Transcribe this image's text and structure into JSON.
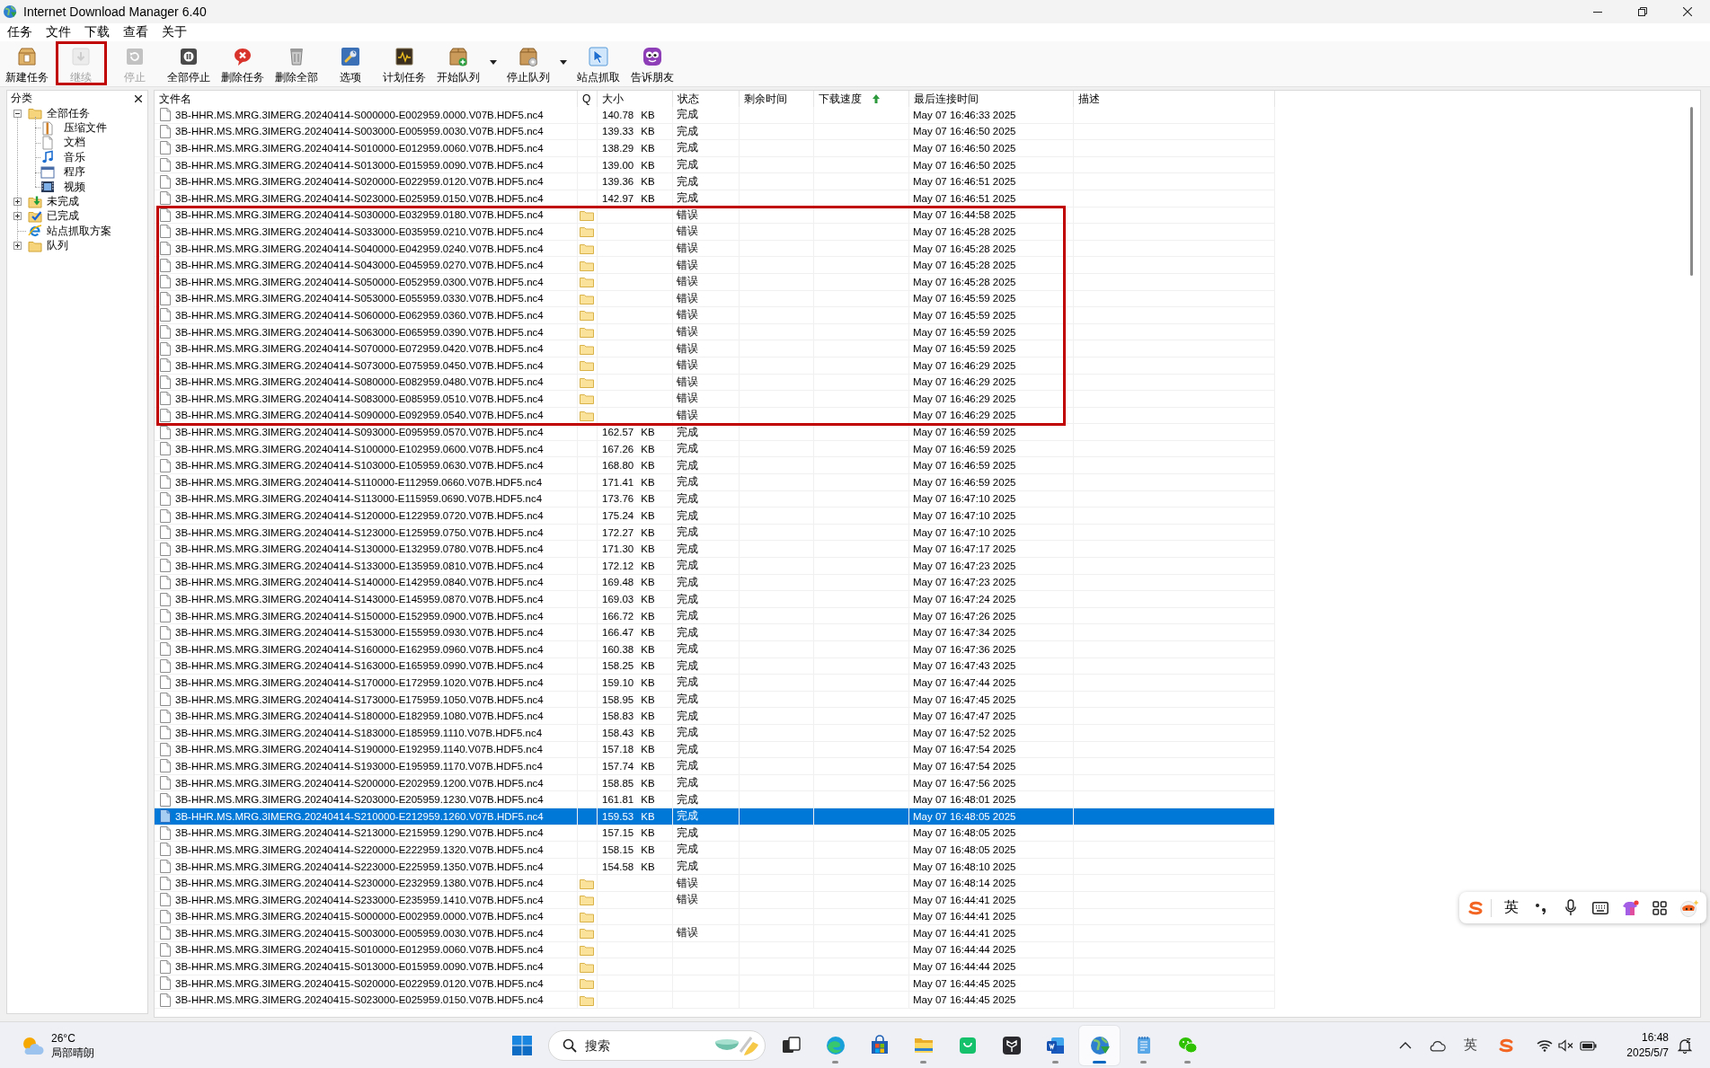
{
  "window": {
    "title": "Internet Download Manager 6.40"
  },
  "menu": [
    "任务",
    "文件",
    "下载",
    "查看",
    "关于"
  ],
  "toolbar": [
    {
      "kind": "button",
      "label": "新建任务",
      "disabled": false,
      "dropdown": false
    },
    {
      "kind": "framed_button",
      "label": "继续",
      "disabled": true,
      "dropdown": false
    },
    {
      "kind": "button",
      "label": "停止",
      "disabled": true,
      "dropdown": false
    },
    {
      "kind": "button",
      "label": "全部停止",
      "disabled": false,
      "dropdown": false
    },
    {
      "kind": "button",
      "label": "删除任务",
      "disabled": false,
      "dropdown": false
    },
    {
      "kind": "button",
      "label": "删除全部",
      "disabled": false,
      "dropdown": false
    },
    {
      "kind": "button",
      "label": "选项",
      "disabled": false,
      "dropdown": false
    },
    {
      "kind": "button",
      "label": "计划任务",
      "disabled": false,
      "dropdown": false
    },
    {
      "kind": "button",
      "label": "开始队列",
      "disabled": false,
      "dropdown": true
    },
    {
      "kind": "button",
      "label": "停止队列",
      "disabled": false,
      "dropdown": true
    },
    {
      "kind": "button",
      "label": "站点抓取",
      "disabled": false,
      "dropdown": false
    },
    {
      "kind": "button",
      "label": "告诉朋友",
      "disabled": false,
      "dropdown": false
    }
  ],
  "sidebar": {
    "title": "分类",
    "tree": [
      {
        "label": "全部任务",
        "expanded": true,
        "children": [
          {
            "label": "压缩文件"
          },
          {
            "label": "文档"
          },
          {
            "label": "音乐"
          },
          {
            "label": "程序"
          },
          {
            "label": "视频"
          }
        ]
      },
      {
        "label": "未完成",
        "expanded": false
      },
      {
        "label": "已完成",
        "expanded": false
      },
      {
        "label": "站点抓取方案"
      },
      {
        "label": "队列",
        "expanded": false
      }
    ]
  },
  "table": {
    "columns": [
      {
        "label": "文件名",
        "sorted": false
      },
      {
        "label": "Q",
        "sorted": false
      },
      {
        "label": "大小",
        "sorted": false
      },
      {
        "label": "状态",
        "sorted": false
      },
      {
        "label": "剩余时间",
        "sorted": false
      },
      {
        "label": "下载速度",
        "sorted": true
      },
      {
        "label": "最后连接时间",
        "sorted": false
      },
      {
        "label": "描述",
        "sorted": false
      }
    ],
    "rows": [
      {
        "kind": "file",
        "name": "3B-HHR.MS.MRG.3IMERG.20240414-S000000-E002959.0000.V07B.HDF5.nc4",
        "queued": false,
        "size": "140.78 KB",
        "status": "完成",
        "last_connection": "May 07 16:46:33 2025",
        "selected": false
      },
      {
        "kind": "file",
        "name": "3B-HHR.MS.MRG.3IMERG.20240414-S003000-E005959.0030.V07B.HDF5.nc4",
        "queued": false,
        "size": "139.33 KB",
        "status": "完成",
        "last_connection": "May 07 16:46:50 2025",
        "selected": false
      },
      {
        "kind": "file",
        "name": "3B-HHR.MS.MRG.3IMERG.20240414-S010000-E012959.0060.V07B.HDF5.nc4",
        "queued": false,
        "size": "138.29 KB",
        "status": "完成",
        "last_connection": "May 07 16:46:50 2025",
        "selected": false
      },
      {
        "kind": "file",
        "name": "3B-HHR.MS.MRG.3IMERG.20240414-S013000-E015959.0090.V07B.HDF5.nc4",
        "queued": false,
        "size": "139.00 KB",
        "status": "完成",
        "last_connection": "May 07 16:46:50 2025",
        "selected": false
      },
      {
        "kind": "file",
        "name": "3B-HHR.MS.MRG.3IMERG.20240414-S020000-E022959.0120.V07B.HDF5.nc4",
        "queued": false,
        "size": "139.36 KB",
        "status": "完成",
        "last_connection": "May 07 16:46:51 2025",
        "selected": false
      },
      {
        "kind": "file",
        "name": "3B-HHR.MS.MRG.3IMERG.20240414-S023000-E025959.0150.V07B.HDF5.nc4",
        "queued": false,
        "size": "142.97 KB",
        "status": "完成",
        "last_connection": "May 07 16:46:51 2025",
        "selected": false
      },
      {
        "kind": "frame",
        "rows": [
          {
            "name": "3B-HHR.MS.MRG.3IMERG.20240414-S030000-E032959.0180.V07B.HDF5.nc4",
            "queued": true,
            "status": "错误",
            "last_connection": "May 07 16:44:58 2025",
            "selected": false
          },
          {
            "name": "3B-HHR.MS.MRG.3IMERG.20240414-S033000-E035959.0210.V07B.HDF5.nc4",
            "queued": true,
            "status": "错误",
            "last_connection": "May 07 16:45:28 2025",
            "selected": false
          },
          {
            "name": "3B-HHR.MS.MRG.3IMERG.20240414-S040000-E042959.0240.V07B.HDF5.nc4",
            "queued": true,
            "status": "错误",
            "last_connection": "May 07 16:45:28 2025",
            "selected": false
          },
          {
            "name": "3B-HHR.MS.MRG.3IMERG.20240414-S043000-E045959.0270.V07B.HDF5.nc4",
            "queued": true,
            "status": "错误",
            "last_connection": "May 07 16:45:28 2025",
            "selected": false
          },
          {
            "name": "3B-HHR.MS.MRG.3IMERG.20240414-S050000-E052959.0300.V07B.HDF5.nc4",
            "queued": true,
            "status": "错误",
            "last_connection": "May 07 16:45:28 2025",
            "selected": false
          },
          {
            "name": "3B-HHR.MS.MRG.3IMERG.20240414-S053000-E055959.0330.V07B.HDF5.nc4",
            "queued": true,
            "status": "错误",
            "last_connection": "May 07 16:45:59 2025",
            "selected": false
          },
          {
            "name": "3B-HHR.MS.MRG.3IMERG.20240414-S060000-E062959.0360.V07B.HDF5.nc4",
            "queued": true,
            "status": "错误",
            "last_connection": "May 07 16:45:59 2025",
            "selected": false
          },
          {
            "name": "3B-HHR.MS.MRG.3IMERG.20240414-S063000-E065959.0390.V07B.HDF5.nc4",
            "queued": true,
            "status": "错误",
            "last_connection": "May 07 16:45:59 2025",
            "selected": false
          },
          {
            "name": "3B-HHR.MS.MRG.3IMERG.20240414-S070000-E072959.0420.V07B.HDF5.nc4",
            "queued": true,
            "status": "错误",
            "last_connection": "May 07 16:45:59 2025",
            "selected": false
          },
          {
            "name": "3B-HHR.MS.MRG.3IMERG.20240414-S073000-E075959.0450.V07B.HDF5.nc4",
            "queued": true,
            "status": "错误",
            "last_connection": "May 07 16:46:29 2025",
            "selected": false
          },
          {
            "name": "3B-HHR.MS.MRG.3IMERG.20240414-S080000-E082959.0480.V07B.HDF5.nc4",
            "queued": true,
            "status": "错误",
            "last_connection": "May 07 16:46:29 2025",
            "selected": false
          },
          {
            "name": "3B-HHR.MS.MRG.3IMERG.20240414-S083000-E085959.0510.V07B.HDF5.nc4",
            "queued": true,
            "status": "错误",
            "last_connection": "May 07 16:46:29 2025",
            "selected": false
          },
          {
            "name": "3B-HHR.MS.MRG.3IMERG.20240414-S090000-E092959.0540.V07B.HDF5.nc4",
            "queued": true,
            "status": "错误",
            "last_connection": "May 07 16:46:29 2025",
            "selected": false
          }
        ]
      },
      {
        "kind": "file",
        "name": "3B-HHR.MS.MRG.3IMERG.20240414-S093000-E095959.0570.V07B.HDF5.nc4",
        "queued": false,
        "size": "162.57 KB",
        "status": "完成",
        "last_connection": "May 07 16:46:59 2025",
        "selected": false
      },
      {
        "kind": "file",
        "name": "3B-HHR.MS.MRG.3IMERG.20240414-S100000-E102959.0600.V07B.HDF5.nc4",
        "queued": false,
        "size": "167.26 KB",
        "status": "完成",
        "last_connection": "May 07 16:46:59 2025",
        "selected": false
      },
      {
        "kind": "file",
        "name": "3B-HHR.MS.MRG.3IMERG.20240414-S103000-E105959.0630.V07B.HDF5.nc4",
        "queued": false,
        "size": "168.80 KB",
        "status": "完成",
        "last_connection": "May 07 16:46:59 2025",
        "selected": false
      },
      {
        "kind": "file",
        "name": "3B-HHR.MS.MRG.3IMERG.20240414-S110000-E112959.0660.V07B.HDF5.nc4",
        "queued": false,
        "size": "171.41 KB",
        "status": "完成",
        "last_connection": "May 07 16:46:59 2025",
        "selected": false
      },
      {
        "kind": "file",
        "name": "3B-HHR.MS.MRG.3IMERG.20240414-S113000-E115959.0690.V07B.HDF5.nc4",
        "queued": false,
        "size": "173.76 KB",
        "status": "完成",
        "last_connection": "May 07 16:47:10 2025",
        "selected": false
      },
      {
        "kind": "file",
        "name": "3B-HHR.MS.MRG.3IMERG.20240414-S120000-E122959.0720.V07B.HDF5.nc4",
        "queued": false,
        "size": "175.24 KB",
        "status": "完成",
        "last_connection": "May 07 16:47:10 2025",
        "selected": false
      },
      {
        "kind": "file",
        "name": "3B-HHR.MS.MRG.3IMERG.20240414-S123000-E125959.0750.V07B.HDF5.nc4",
        "queued": false,
        "size": "172.27 KB",
        "status": "完成",
        "last_connection": "May 07 16:47:10 2025",
        "selected": false
      },
      {
        "kind": "file",
        "name": "3B-HHR.MS.MRG.3IMERG.20240414-S130000-E132959.0780.V07B.HDF5.nc4",
        "queued": false,
        "size": "171.30 KB",
        "status": "完成",
        "last_connection": "May 07 16:47:17 2025",
        "selected": false
      },
      {
        "kind": "file",
        "name": "3B-HHR.MS.MRG.3IMERG.20240414-S133000-E135959.0810.V07B.HDF5.nc4",
        "queued": false,
        "size": "172.12 KB",
        "status": "完成",
        "last_connection": "May 07 16:47:23 2025",
        "selected": false
      },
      {
        "kind": "file",
        "name": "3B-HHR.MS.MRG.3IMERG.20240414-S140000-E142959.0840.V07B.HDF5.nc4",
        "queued": false,
        "size": "169.48 KB",
        "status": "完成",
        "last_connection": "May 07 16:47:23 2025",
        "selected": false
      },
      {
        "kind": "file",
        "name": "3B-HHR.MS.MRG.3IMERG.20240414-S143000-E145959.0870.V07B.HDF5.nc4",
        "queued": false,
        "size": "169.03 KB",
        "status": "完成",
        "last_connection": "May 07 16:47:24 2025",
        "selected": false
      },
      {
        "kind": "file",
        "name": "3B-HHR.MS.MRG.3IMERG.20240414-S150000-E152959.0900.V07B.HDF5.nc4",
        "queued": false,
        "size": "166.72 KB",
        "status": "完成",
        "last_connection": "May 07 16:47:26 2025",
        "selected": false
      },
      {
        "kind": "file",
        "name": "3B-HHR.MS.MRG.3IMERG.20240414-S153000-E155959.0930.V07B.HDF5.nc4",
        "queued": false,
        "size": "166.47 KB",
        "status": "完成",
        "last_connection": "May 07 16:47:34 2025",
        "selected": false
      },
      {
        "kind": "file",
        "name": "3B-HHR.MS.MRG.3IMERG.20240414-S160000-E162959.0960.V07B.HDF5.nc4",
        "queued": false,
        "size": "160.38 KB",
        "status": "完成",
        "last_connection": "May 07 16:47:36 2025",
        "selected": false
      },
      {
        "kind": "file",
        "name": "3B-HHR.MS.MRG.3IMERG.20240414-S163000-E165959.0990.V07B.HDF5.nc4",
        "queued": false,
        "size": "158.25 KB",
        "status": "完成",
        "last_connection": "May 07 16:47:43 2025",
        "selected": false
      },
      {
        "kind": "file",
        "name": "3B-HHR.MS.MRG.3IMERG.20240414-S170000-E172959.1020.V07B.HDF5.nc4",
        "queued": false,
        "size": "159.10 KB",
        "status": "完成",
        "last_connection": "May 07 16:47:44 2025",
        "selected": false
      },
      {
        "kind": "file",
        "name": "3B-HHR.MS.MRG.3IMERG.20240414-S173000-E175959.1050.V07B.HDF5.nc4",
        "queued": false,
        "size": "158.95 KB",
        "status": "完成",
        "last_connection": "May 07 16:47:45 2025",
        "selected": false
      },
      {
        "kind": "file",
        "name": "3B-HHR.MS.MRG.3IMERG.20240414-S180000-E182959.1080.V07B.HDF5.nc4",
        "queued": false,
        "size": "158.83 KB",
        "status": "完成",
        "last_connection": "May 07 16:47:47 2025",
        "selected": false
      },
      {
        "kind": "file",
        "name": "3B-HHR.MS.MRG.3IMERG.20240414-S183000-E185959.1110.V07B.HDF5.nc4",
        "queued": false,
        "size": "158.43 KB",
        "status": "完成",
        "last_connection": "May 07 16:47:52 2025",
        "selected": false
      },
      {
        "kind": "file",
        "name": "3B-HHR.MS.MRG.3IMERG.20240414-S190000-E192959.1140.V07B.HDF5.nc4",
        "queued": false,
        "size": "157.18 KB",
        "status": "完成",
        "last_connection": "May 07 16:47:54 2025",
        "selected": false
      },
      {
        "kind": "file",
        "name": "3B-HHR.MS.MRG.3IMERG.20240414-S193000-E195959.1170.V07B.HDF5.nc4",
        "queued": false,
        "size": "157.74 KB",
        "status": "完成",
        "last_connection": "May 07 16:47:54 2025",
        "selected": false
      },
      {
        "kind": "file",
        "name": "3B-HHR.MS.MRG.3IMERG.20240414-S200000-E202959.1200.V07B.HDF5.nc4",
        "queued": false,
        "size": "158.85 KB",
        "status": "完成",
        "last_connection": "May 07 16:47:56 2025",
        "selected": false
      },
      {
        "kind": "file",
        "name": "3B-HHR.MS.MRG.3IMERG.20240414-S203000-E205959.1230.V07B.HDF5.nc4",
        "queued": false,
        "size": "161.81 KB",
        "status": "完成",
        "last_connection": "May 07 16:48:01 2025",
        "selected": false
      },
      {
        "kind": "file",
        "name": "3B-HHR.MS.MRG.3IMERG.20240414-S210000-E212959.1260.V07B.HDF5.nc4",
        "queued": false,
        "size": "159.53 KB",
        "status": "完成",
        "last_connection": "May 07 16:48:05 2025",
        "selected": true
      },
      {
        "kind": "file",
        "name": "3B-HHR.MS.MRG.3IMERG.20240414-S213000-E215959.1290.V07B.HDF5.nc4",
        "queued": false,
        "size": "157.15 KB",
        "status": "完成",
        "last_connection": "May 07 16:48:05 2025",
        "selected": false
      },
      {
        "kind": "file",
        "name": "3B-HHR.MS.MRG.3IMERG.20240414-S220000-E222959.1320.V07B.HDF5.nc4",
        "queued": false,
        "size": "158.15 KB",
        "status": "完成",
        "last_connection": "May 07 16:48:05 2025",
        "selected": false
      },
      {
        "kind": "file",
        "name": "3B-HHR.MS.MRG.3IMERG.20240414-S223000-E225959.1350.V07B.HDF5.nc4",
        "queued": false,
        "size": "154.58 KB",
        "status": "完成",
        "last_connection": "May 07 16:48:10 2025",
        "selected": false
      },
      {
        "kind": "file",
        "name": "3B-HHR.MS.MRG.3IMERG.20240414-S230000-E232959.1380.V07B.HDF5.nc4",
        "queued": true,
        "status": "错误",
        "last_connection": "May 07 16:48:14 2025",
        "selected": false
      },
      {
        "kind": "file",
        "name": "3B-HHR.MS.MRG.3IMERG.20240414-S233000-E235959.1410.V07B.HDF5.nc4",
        "queued": true,
        "status": "错误",
        "last_connection": "May 07 16:44:41 2025",
        "selected": false
      },
      {
        "kind": "file",
        "name": "3B-HHR.MS.MRG.3IMERG.20240415-S000000-E002959.0000.V07B.HDF5.nc4",
        "queued": true,
        "last_connection": "May 07 16:44:41 2025",
        "selected": false
      },
      {
        "kind": "file",
        "name": "3B-HHR.MS.MRG.3IMERG.20240415-S003000-E005959.0030.V07B.HDF5.nc4",
        "queued": true,
        "status": "错误",
        "last_connection": "May 07 16:44:41 2025",
        "selected": false
      },
      {
        "kind": "file",
        "name": "3B-HHR.MS.MRG.3IMERG.20240415-S010000-E012959.0060.V07B.HDF5.nc4",
        "queued": true,
        "last_connection": "May 07 16:44:44 2025",
        "selected": false
      },
      {
        "kind": "file",
        "name": "3B-HHR.MS.MRG.3IMERG.20240415-S013000-E015959.0090.V07B.HDF5.nc4",
        "queued": true,
        "last_connection": "May 07 16:44:44 2025",
        "selected": false
      },
      {
        "kind": "file",
        "name": "3B-HHR.MS.MRG.3IMERG.20240415-S020000-E022959.0120.V07B.HDF5.nc4",
        "queued": true,
        "last_connection": "May 07 16:44:45 2025",
        "selected": false
      },
      {
        "kind": "file",
        "name": "3B-HHR.MS.MRG.3IMERG.20240415-S023000-E025959.0150.V07B.HDF5.nc4",
        "queued": true,
        "last_connection": "May 07 16:44:45 2025",
        "selected": false
      }
    ]
  },
  "ime_toolbar": {
    "mode": "英"
  },
  "taskbar": {
    "weather": {
      "temperature": "26°C",
      "condition": "局部晴朗"
    },
    "search": {
      "placeholder": "搜索"
    },
    "apps": [
      {
        "running": false,
        "selected": false
      },
      {
        "running": true,
        "selected": false
      },
      {
        "running": false,
        "selected": false
      },
      {
        "running": true,
        "selected": false
      },
      {
        "running": false,
        "selected": false
      },
      {
        "running": false,
        "selected": false
      },
      {
        "running": true,
        "selected": false
      },
      {
        "running": true,
        "selected": true
      },
      {
        "running": true,
        "selected": false
      },
      {
        "running": true,
        "selected": false
      }
    ],
    "ime_mode": "英",
    "clock": {
      "time": "16:48",
      "date": "2025/5/7"
    }
  }
}
